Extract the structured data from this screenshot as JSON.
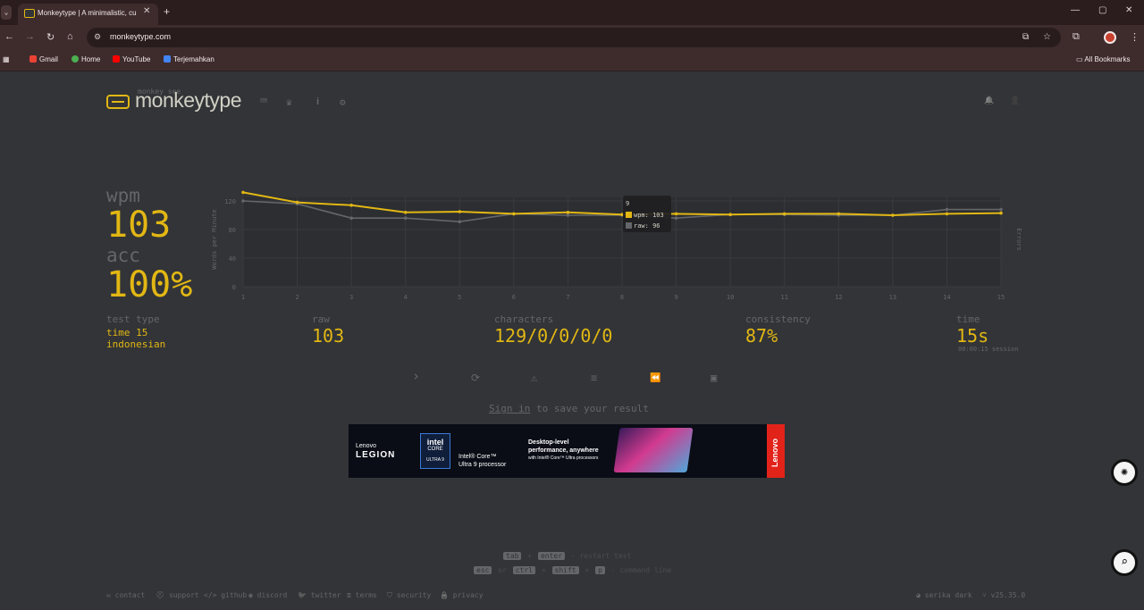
{
  "browser": {
    "tab_list_icon": "chevron-down-icon",
    "tab_title": "Monkeytype | A minimalistic, cu",
    "url": "monkeytype.com",
    "bookmarks": [
      "Gmail",
      "Home",
      "YouTube",
      "Terjemahkan"
    ],
    "all_bookmarks": "All Bookmarks",
    "symbols": {
      "back": "←",
      "forward": "→",
      "reload": "↻",
      "home": "⌂",
      "new_tab": "+",
      "close": "✕",
      "minimize": "—",
      "maximize": "▢",
      "window_close": "✕",
      "star": "☆",
      "menu": "⋮",
      "bookmark_folder": "▭"
    },
    "accent_colors": {
      "tabbar": "#2b1d1e",
      "toolbar": "#3e2c2d"
    }
  },
  "header": {
    "logo_small": "monkey see",
    "logo_text": "monkeytype",
    "nav_icons": [
      "keyboard-icon",
      "crown-icon",
      "info-icon",
      "settings-icon"
    ],
    "nav_glyphs": [
      "⌨",
      "♛",
      "i",
      "⚙"
    ],
    "right_icons": [
      "bell-icon",
      "user-icon"
    ],
    "right_glyphs": [
      "🔔",
      "👤"
    ]
  },
  "result": {
    "wpm_label": "wpm",
    "wpm_value": "103",
    "acc_label": "acc",
    "acc_value": "100%",
    "test_type_label": "test type",
    "test_type_line1": "time 15",
    "test_type_line2": "indonesian",
    "raw_label": "raw",
    "raw_value": "103",
    "characters_label": "characters",
    "characters_value": "129/0/0/0/0",
    "consistency_label": "consistency",
    "consistency_value": "87%",
    "time_label": "time",
    "time_value": "15s",
    "time_session": "00:00:15 session"
  },
  "actions": {
    "icons": [
      "next-test-icon",
      "restart-icon",
      "report-icon",
      "words-history-icon",
      "replay-icon",
      "screenshot-icon"
    ],
    "glyphs": [
      "›",
      "⟳",
      "⚠",
      "≡",
      "⏪",
      "▣"
    ]
  },
  "signin": {
    "link": "Sign in",
    "text": " to save your result"
  },
  "ad": {
    "brand_small": "Lenovo",
    "brand": "LEGION",
    "chip_line1": "intel",
    "chip_line2": "CORE",
    "chip_line3": "ULTRA 9",
    "text1_line1": "Intel® Core™",
    "text1_line2": "Ultra 9 processor",
    "text2_line1": "Desktop-level",
    "text2_line2": "performance, anywhere",
    "text2_line3": "with Intel® Core™ Ultra processors",
    "vertical": "Lenovo"
  },
  "side_buttons": {
    "top": "✺",
    "bottom": "⌕"
  },
  "hints": {
    "line1_keys": [
      "tab",
      "enter"
    ],
    "line1_plus": "+",
    "line1_text": "- restart test",
    "line2_keys": [
      "esc",
      "ctrl",
      "shift",
      "p"
    ],
    "line2_or": "or",
    "line2_plus": "+",
    "line2_text": "- command line"
  },
  "footer": {
    "left": [
      "contact",
      "support",
      "github",
      "discord",
      "twitter",
      "terms",
      "security",
      "privacy"
    ],
    "left_icons": [
      "mail-icon",
      "support-icon",
      "code-icon",
      "discord-icon",
      "twitter-icon",
      "terms-icon",
      "shield-icon",
      "lock-icon"
    ],
    "left_glyphs": [
      "✉",
      "⛑",
      "</>",
      "◉",
      "🐦",
      "≣",
      "⛉",
      "🔒"
    ],
    "theme": "serika dark",
    "version": "v25.35.0"
  },
  "chart_data": {
    "type": "line",
    "x": [
      1,
      2,
      3,
      4,
      5,
      6,
      7,
      8,
      9,
      10,
      11,
      12,
      13,
      14,
      15
    ],
    "series": [
      {
        "name": "wpm",
        "values": [
          132,
          118,
          114,
          104,
          105,
          102,
          104,
          101,
          102,
          101,
          102,
          102,
          100,
          102,
          103
        ]
      },
      {
        "name": "raw",
        "values": [
          120,
          116,
          96,
          96,
          91,
          102,
          100,
          100,
          96,
          101,
          101,
          100,
          100,
          108,
          108
        ]
      }
    ],
    "ylabel": "Words per Minute",
    "y2label": "Errors",
    "yticks": [
      0,
      40,
      80,
      120
    ],
    "ylim": [
      0,
      125
    ],
    "tooltip": {
      "title": "9",
      "wpm": "wpm: 103",
      "raw": "raw: 96"
    },
    "colors": {
      "wpm": "#e2b714",
      "raw": "#646669"
    }
  }
}
